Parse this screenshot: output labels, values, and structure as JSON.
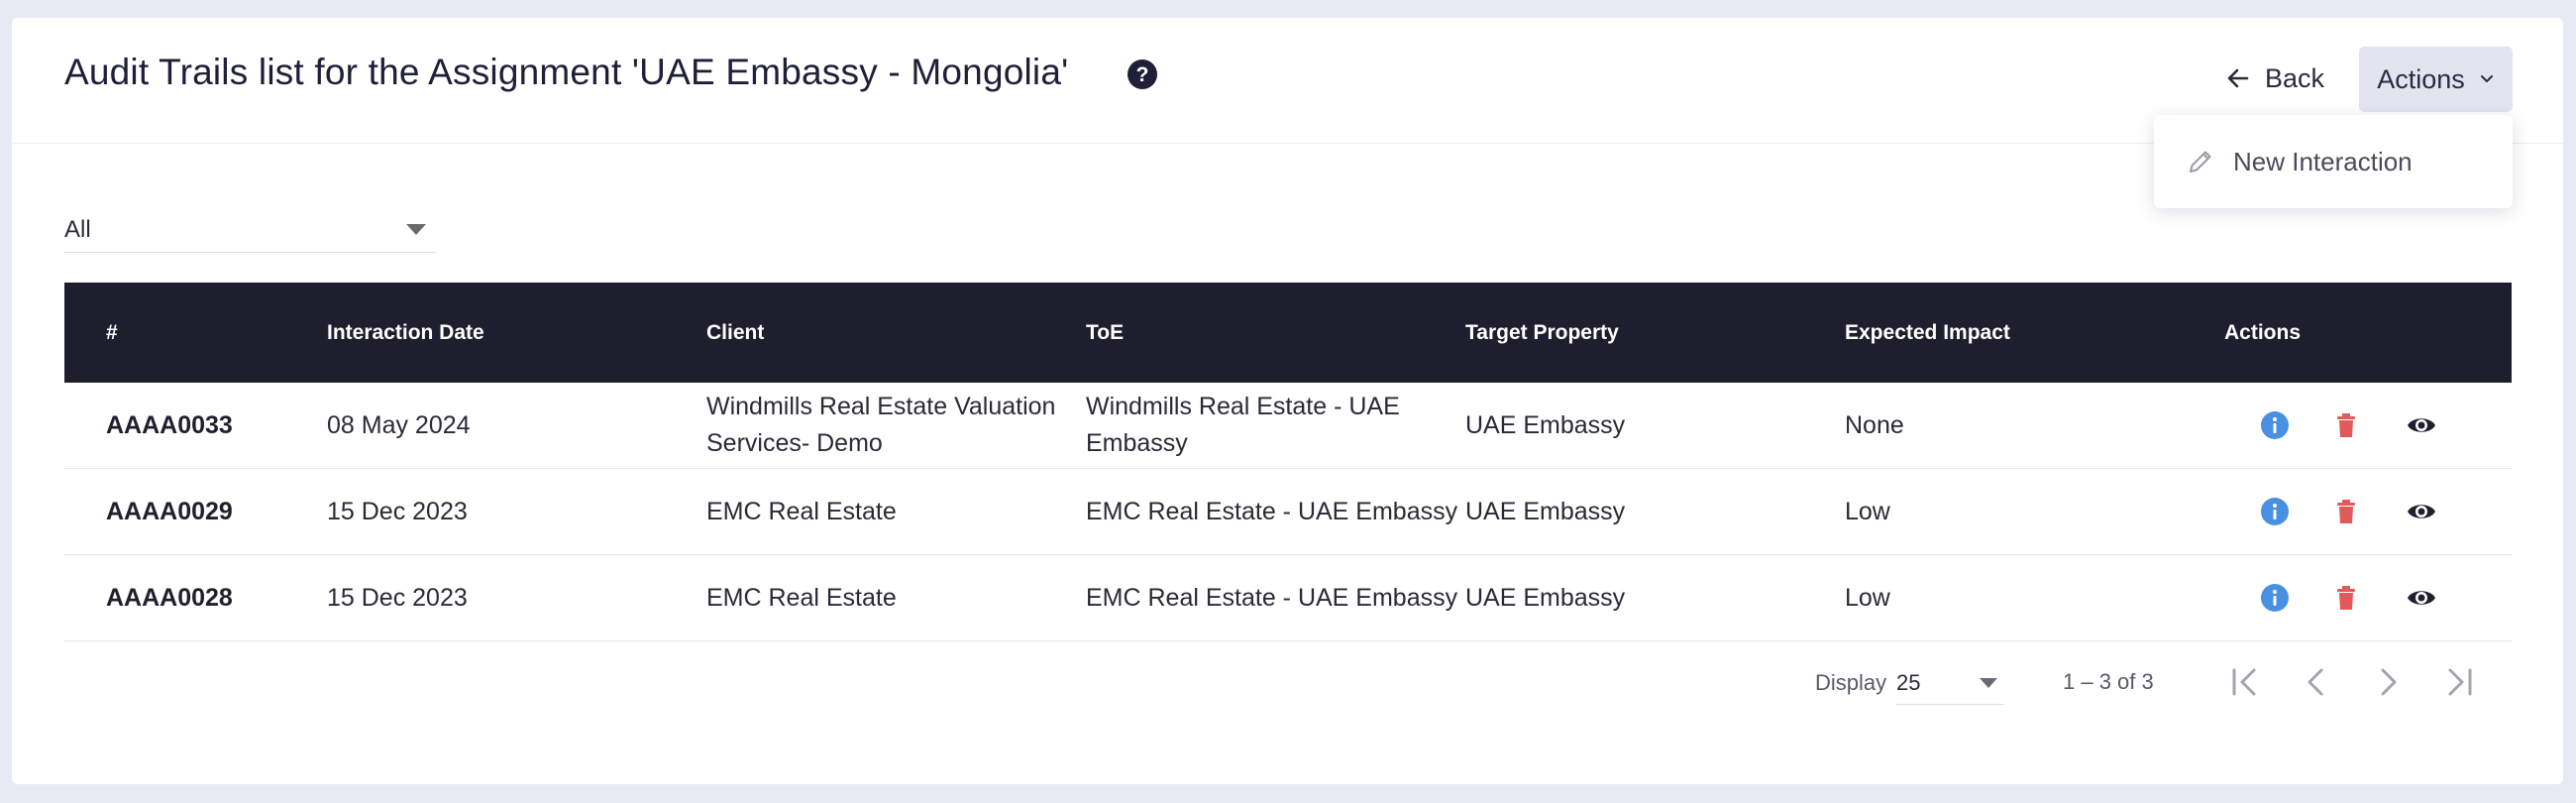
{
  "header": {
    "title": "Audit Trails list for the Assignment 'UAE Embassy - Mongolia'",
    "back_label": "Back",
    "actions_label": "Actions"
  },
  "actions_menu": {
    "items": [
      {
        "label": "New Interaction",
        "icon": "pencil-icon"
      }
    ]
  },
  "filter": {
    "value": "All"
  },
  "table": {
    "columns": [
      "#",
      "Interaction Date",
      "Client",
      "ToE",
      "Target Property",
      "Expected Impact",
      "Actions"
    ],
    "rows": [
      {
        "id": "AAAA0033",
        "date": "08 May 2024",
        "client": "Windmills Real Estate Valuation Services- Demo",
        "toe": "Windmills Real Estate - UAE Embassy",
        "target": "UAE Embassy",
        "impact": "None"
      },
      {
        "id": "AAAA0029",
        "date": "15 Dec 2023",
        "client": "EMC Real Estate",
        "toe": "EMC Real Estate - UAE Embassy",
        "target": "UAE Embassy",
        "impact": "Low"
      },
      {
        "id": "AAAA0028",
        "date": "15 Dec 2023",
        "client": "EMC Real Estate",
        "toe": "EMC Real Estate - UAE Embassy",
        "target": "UAE Embassy",
        "impact": "Low"
      }
    ],
    "row_action_icons": [
      "info-icon",
      "trash-icon",
      "eye-icon"
    ]
  },
  "pagination": {
    "display_label": "Display",
    "page_size": "25",
    "range": "1 – 3 of 3"
  },
  "colors": {
    "header_bg": "#1f1e2e",
    "info": "#4a90e2",
    "delete": "#e05a5a",
    "view": "#1f1f2e",
    "page_bg": "#e8eaf3"
  }
}
